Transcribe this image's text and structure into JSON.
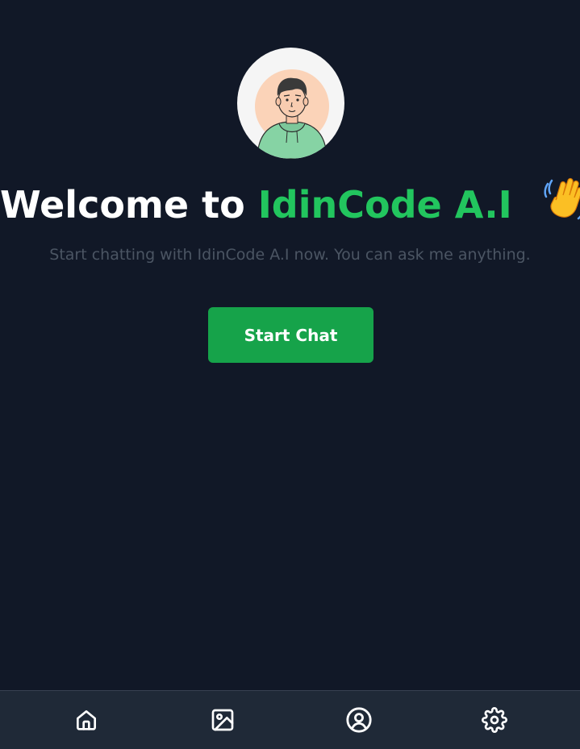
{
  "welcome": {
    "title_prefix": "Welcome to",
    "brand_name": "IdinCode A.I",
    "wave_emoji": "👋",
    "subtitle": "Start chatting with IdinCode A.I now. You can ask me anything."
  },
  "actions": {
    "start_chat_label": "Start Chat"
  },
  "bottom_nav": {
    "items": [
      {
        "icon": "home-icon"
      },
      {
        "icon": "image-icon"
      },
      {
        "icon": "user-circle-icon"
      },
      {
        "icon": "settings-icon"
      }
    ]
  },
  "colors": {
    "background": "#111827",
    "accent": "#22c55e",
    "button": "#16a34a",
    "nav_background": "#1f2937",
    "subtitle": "#4b5563"
  }
}
